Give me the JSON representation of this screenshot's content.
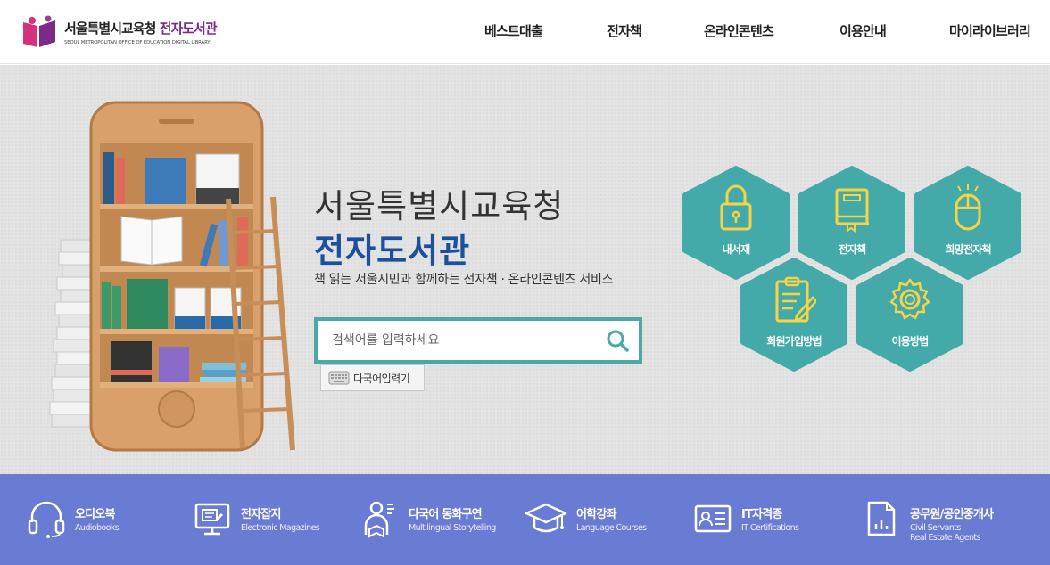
{
  "header": {
    "logo_main_a": "서울특별시교육청",
    "logo_main_b": "전자도서관",
    "logo_sub": "SEOUL METROPOLITAN OFFICE OF EDUCATION DIGITAL LIBRARY",
    "nav": [
      "베스트대출",
      "전자책",
      "온라인콘텐츠",
      "이용안내",
      "마이라이브러리"
    ]
  },
  "hero": {
    "title_line1": "서울특별시교육청",
    "title_line2": "전자도서관",
    "subtitle": "책 읽는 서울시민과 함께하는 전자책 · 온라인콘텐츠 서비스",
    "search_placeholder": "검색어를 입력하세요",
    "multilang_label": "다국어입력기",
    "quick_links": [
      {
        "label": "내서재",
        "icon": "lock-icon"
      },
      {
        "label": "전자책",
        "icon": "book-icon"
      },
      {
        "label": "희망전자책",
        "icon": "mouse-icon"
      },
      {
        "label": "회원가입방법",
        "icon": "clipboard-icon"
      },
      {
        "label": "이용방법",
        "icon": "gear-icon"
      }
    ]
  },
  "categories": [
    {
      "title": "오디오북",
      "sub": "Audiobooks",
      "icon": "headphones-icon"
    },
    {
      "title": "전자잡지",
      "sub": "Electronic Magazines",
      "icon": "monitor-icon"
    },
    {
      "title": "다국어 동화구연",
      "sub": "Multilingual Storytelling",
      "icon": "storyteller-icon"
    },
    {
      "title": "어학강좌",
      "sub": "Language Courses",
      "icon": "graduation-cap-icon"
    },
    {
      "title": "IT자격증",
      "sub": "IT Certifications",
      "icon": "id-card-icon"
    },
    {
      "title": "공무원/공인중개사",
      "sub": "Civil Servants\nReal Estate Agents",
      "icon": "document-chart-icon"
    }
  ],
  "colors": {
    "teal": "#4aa9a4",
    "title_blue": "#1c4f9c",
    "bottom_bar": "#6a7bd3",
    "logo_purple": "#7b2a86",
    "hex_icon_yellow": "#f5d547"
  }
}
